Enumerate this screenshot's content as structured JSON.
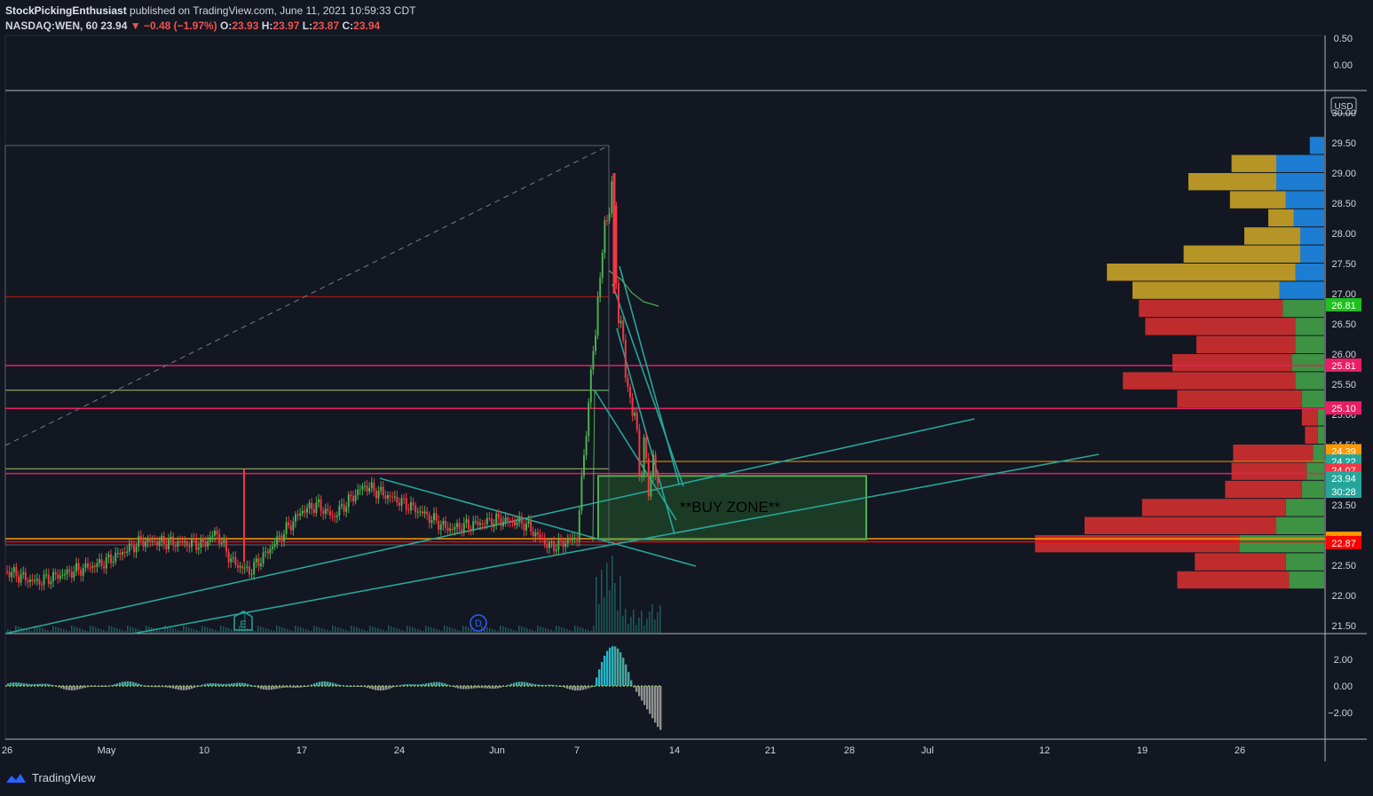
{
  "header": {
    "publisher": "StockPickingEnthusiast",
    "publisher_suffix": " published on TradingView.com, June 11, 2021 10:59:33 CDT",
    "symbol": "NASDAQ:WEN, 60",
    "last": "23.94",
    "change": "▼ −0.48 (−1.97%)",
    "o_label": "O:",
    "o": "23.93",
    "h_label": "H:",
    "h": "23.97",
    "l_label": "L:",
    "l": "23.87",
    "c_label": "C:",
    "c": "23.94"
  },
  "footer": {
    "brand": "TradingView"
  },
  "colors": {
    "background": "#131722",
    "up": "#26a69a",
    "down": "#ef5350",
    "green_candle": "#4caf50",
    "red_candle": "#f23645",
    "magenta_line": "#e91e63",
    "orange_line": "#ff9800",
    "teal_line": "#26a69a",
    "buy_zone": "#2e7d32"
  },
  "chart_data": {
    "type": "candlestick",
    "currency": "USD",
    "top_panel": {
      "tick_labels": [
        "0.50",
        "0.00"
      ]
    },
    "y_tick_labels": [
      "30.00",
      "29.50",
      "29.00",
      "28.50",
      "28.00",
      "27.50",
      "27.00",
      "26.50",
      "26.00",
      "25.50",
      "25.00",
      "24.50",
      "24.00",
      "23.50",
      "23.00",
      "22.50",
      "22.00",
      "21.50"
    ],
    "ylim": [
      21.4,
      30.2
    ],
    "x_tick_labels": [
      "26",
      "May",
      "10",
      "17",
      "24",
      "Jun",
      "7",
      "14",
      "21",
      "28",
      "Jul",
      "12",
      "19",
      "26"
    ],
    "price_tags": [
      {
        "value": "26.81",
        "price": 26.81,
        "color": "#1ec11e"
      },
      {
        "value": "25.81",
        "price": 25.81,
        "color": "#e91e63"
      },
      {
        "value": "25.10",
        "price": 25.1,
        "color": "#e91e63"
      },
      {
        "value": "24.39",
        "price": 24.39,
        "color": "#ff9800"
      },
      {
        "value": "24.22",
        "price": 24.22,
        "color": "#26a69a"
      },
      {
        "value": "24.07",
        "price": 24.07,
        "color": "#f23645"
      },
      {
        "value": "23.94",
        "price": 23.94,
        "color": "#26a69a"
      },
      {
        "value": "30:28",
        "price": 23.72,
        "color": "#26a69a"
      },
      {
        "value": "22.94",
        "price": 22.94,
        "color": "#ff9800"
      },
      {
        "value": "22.87",
        "price": 22.87,
        "color": "#ff0000"
      }
    ],
    "horizontal_levels": [
      {
        "price": 26.95,
        "color": "#b71c1c",
        "extent": "partial"
      },
      {
        "price": 25.81,
        "color": "#e91e63",
        "extent": "full"
      },
      {
        "price": 25.4,
        "color": "#9ccc65",
        "extent": "partial"
      },
      {
        "price": 25.1,
        "color": "#e91e63",
        "extent": "full"
      },
      {
        "price": 24.22,
        "color": "#ff9800",
        "extent": "partial"
      },
      {
        "price": 24.1,
        "color": "#9ccc65",
        "extent": "partial"
      },
      {
        "price": 24.02,
        "color": "#e91e63",
        "extent": "full"
      },
      {
        "price": 22.94,
        "color": "#ff9800",
        "extent": "full"
      },
      {
        "price": 22.89,
        "color": "#ff0000",
        "extent": "full"
      }
    ],
    "buy_zone": {
      "label": "**BUY ZONE**",
      "price_top": 23.98,
      "price_bottom": 22.93,
      "start": "Jun 8",
      "end": "Jun 25"
    },
    "price_path": [
      {
        "t": "Apr 26",
        "price": 22.4
      },
      {
        "t": "Apr 29",
        "price": 22.22
      },
      {
        "t": "May 3",
        "price": 22.55
      },
      {
        "t": "May 6",
        "price": 22.9
      },
      {
        "t": "May 10",
        "price": 22.85
      },
      {
        "t": "May 11",
        "price": 23.05
      },
      {
        "t": "May 12",
        "price": 22.55
      },
      {
        "t": "May 13",
        "price": 22.4
      },
      {
        "t": "May 14",
        "price": 22.7
      },
      {
        "t": "May 17",
        "price": 23.4
      },
      {
        "t": "May 18",
        "price": 23.5
      },
      {
        "t": "May 19",
        "price": 23.3
      },
      {
        "t": "May 21",
        "price": 23.82
      },
      {
        "t": "May 24",
        "price": 23.55
      },
      {
        "t": "May 26",
        "price": 23.35
      },
      {
        "t": "May 28",
        "price": 23.1
      },
      {
        "t": "Jun 1",
        "price": 23.25
      },
      {
        "t": "Jun 3",
        "price": 23.2
      },
      {
        "t": "Jun 5",
        "price": 22.8
      },
      {
        "t": "Jun 7",
        "price": 22.95
      },
      {
        "t": "Jun 8",
        "price": 26.7
      },
      {
        "t": "Jun 8 pm",
        "price": 28.9
      },
      {
        "t": "Jun 9",
        "price": 26.2
      },
      {
        "t": "Jun 10",
        "price": 24.2
      },
      {
        "t": "Jun 11",
        "price": 23.94
      }
    ],
    "series": [
      {
        "name": "volume profile (buy)",
        "bins": [
          29.45,
          29.15,
          28.85,
          28.55,
          28.25,
          27.95,
          27.65,
          27.35,
          27.05,
          26.75,
          26.45,
          26.15,
          25.85,
          25.55,
          25.25,
          24.95,
          24.65,
          24.35,
          24.05,
          23.75,
          23.45,
          23.15,
          22.85,
          22.55,
          22.25
        ],
        "values": [
          0.09,
          0.3,
          0.3,
          0.24,
          0.19,
          0.15,
          0.15,
          0.18,
          0.28,
          0.26,
          0.18,
          0.18,
          0.2,
          0.18,
          0.14,
          0.04,
          0.04,
          0.07,
          0.11,
          0.14,
          0.24,
          0.3,
          0.53,
          0.24,
          0.22
        ]
      },
      {
        "name": "volume profile (sell)",
        "bins": [
          29.45,
          29.15,
          28.85,
          28.55,
          28.25,
          27.95,
          27.65,
          27.35,
          27.05,
          26.75,
          26.45,
          26.15,
          25.85,
          25.55,
          25.25,
          24.95,
          24.65,
          24.35,
          24.05,
          23.75,
          23.45,
          23.15,
          22.85,
          22.55,
          22.25
        ],
        "values": [
          0.0,
          0.28,
          0.55,
          0.35,
          0.16,
          0.35,
          0.73,
          1.18,
          0.92,
          0.9,
          0.94,
          0.62,
          0.75,
          1.08,
          0.78,
          0.1,
          0.08,
          0.5,
          0.47,
          0.48,
          0.9,
          1.2,
          1.28,
          0.57,
          0.7
        ]
      },
      {
        "name": "oscillator",
        "tick_labels": [
          "2.00",
          "0.00",
          "−2.00"
        ],
        "values": [
          0.1,
          0.2,
          0.1,
          0.3,
          0.2,
          -0.3,
          0.4,
          0.2,
          0.1,
          -0.4,
          -0.3,
          0.2,
          0.1,
          -0.3,
          0.0,
          0.1,
          2.9,
          -1.0,
          -3.3
        ]
      }
    ],
    "events": [
      {
        "label": "E",
        "t": "May 12"
      },
      {
        "label": "D",
        "t": "May 31"
      }
    ]
  }
}
